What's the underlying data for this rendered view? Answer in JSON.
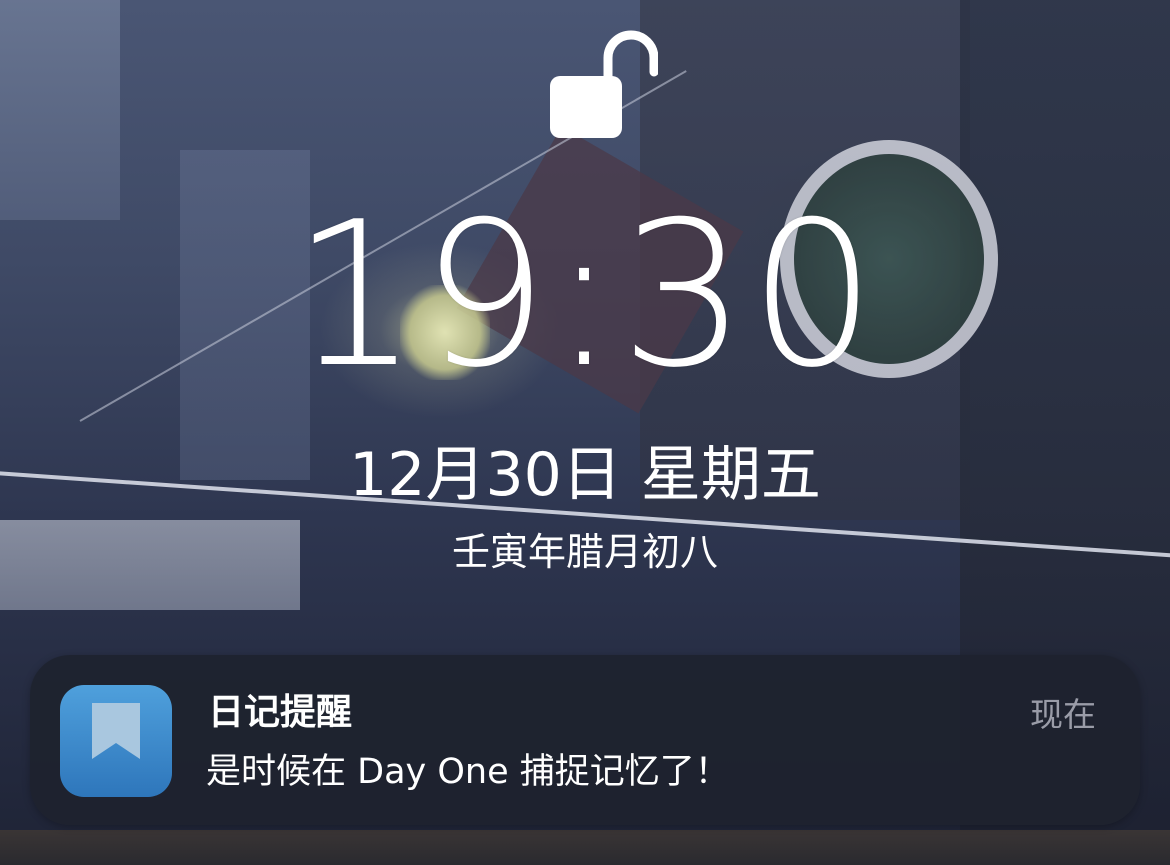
{
  "lock_screen": {
    "lock_icon": "unlocked-padlock-icon",
    "time": "19:30",
    "date": "12月30日 星期五",
    "lunar_date": "壬寅年腊月初八"
  },
  "notification": {
    "app_icon": "day-one-bookmark-icon",
    "title": "日记提醒",
    "body": "是时候在 Day One 捕捉记忆了！",
    "timestamp": "现在"
  },
  "colors": {
    "notification_bg": "#1e222e",
    "app_icon_blue": "#3a88c9",
    "timestamp_gray": "#9a9ca8",
    "text_white": "#ffffff"
  }
}
